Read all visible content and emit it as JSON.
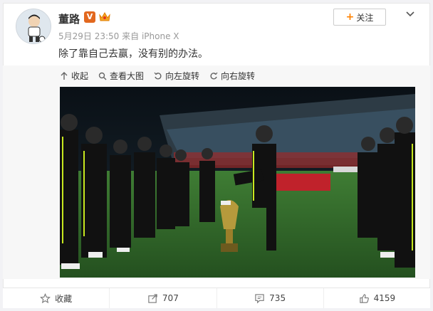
{
  "post": {
    "username": "董路",
    "vip_badge": "V",
    "timestamp": "5月29日 23:50",
    "source": "来自 iPhone X",
    "text": "除了靠自己去赢，没有别的办法。",
    "follow_label": "关注"
  },
  "toolbar": {
    "collapse": "收起",
    "view_large": "查看大图",
    "rotate_left": "向左旋转",
    "rotate_right": "向右旋转"
  },
  "footer": {
    "favorite": "收藏",
    "repost_count": "707",
    "comment_count": "735",
    "like_count": "4159"
  },
  "colors": {
    "accent": "#ff8200",
    "vip": "#e2681f",
    "pitch": "#2e6a2c"
  }
}
